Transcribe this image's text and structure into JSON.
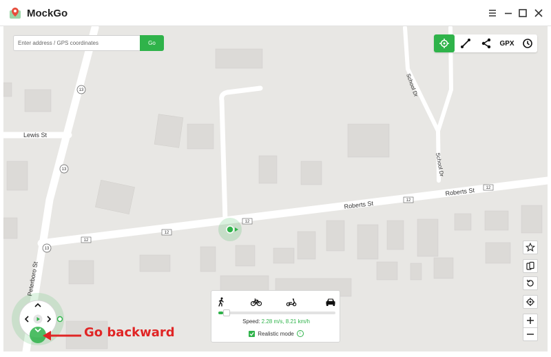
{
  "app": {
    "title": "MockGo",
    "logo_icon": "map-pin-logo-icon"
  },
  "window_controls": [
    {
      "name": "menu-icon"
    },
    {
      "name": "minimize-icon"
    },
    {
      "name": "maximize-icon"
    },
    {
      "name": "close-icon"
    }
  ],
  "search": {
    "placeholder": "Enter address / GPS coordinates",
    "value": "",
    "go_label": "Go"
  },
  "toolbar": {
    "items": [
      {
        "name": "teleport-mode-icon",
        "active": true
      },
      {
        "name": "two-spot-route-icon",
        "active": false
      },
      {
        "name": "multi-spot-route-icon",
        "active": false
      },
      {
        "label": "GPX",
        "name": "gpx-button"
      },
      {
        "name": "history-icon",
        "active": false
      }
    ]
  },
  "map": {
    "street_labels": [
      "Lewis St",
      "Roberts St",
      "Roberts St",
      "School Dr",
      "School Dr",
      "Peterboro St"
    ],
    "route_shields": [
      "13",
      "13",
      "13",
      "12",
      "12",
      "12",
      "12",
      "12"
    ],
    "marker_color": "#2fb34a"
  },
  "side_tools": [
    {
      "name": "favorites-star-icon"
    },
    {
      "name": "device-switch-icon"
    },
    {
      "name": "reset-location-icon"
    },
    {
      "name": "locate-me-icon"
    },
    {
      "name": "zoom-in-icon"
    },
    {
      "name": "zoom-out-icon"
    }
  ],
  "speed_panel": {
    "modes": [
      "walk-icon",
      "bike-icon",
      "scooter-icon",
      "car-icon"
    ],
    "active_mode": "car-icon",
    "speed_fraction": 0.04,
    "speed_label": "Speed:",
    "speed_value": "2.28 m/s, 8.21 km/h",
    "realistic_label": "Realistic mode",
    "realistic_checked": true
  },
  "joystick": {
    "buttons": [
      "move-up-icon",
      "move-left-icon",
      "play-icon",
      "move-right-icon",
      "move-down-icon"
    ]
  },
  "annotation": {
    "text": "Go backward",
    "color": "#e02525"
  },
  "colors": {
    "accent": "#2fb34a",
    "map_bg": "#e8e7e4",
    "road": "#ffffff",
    "building": "#dcdad7"
  }
}
